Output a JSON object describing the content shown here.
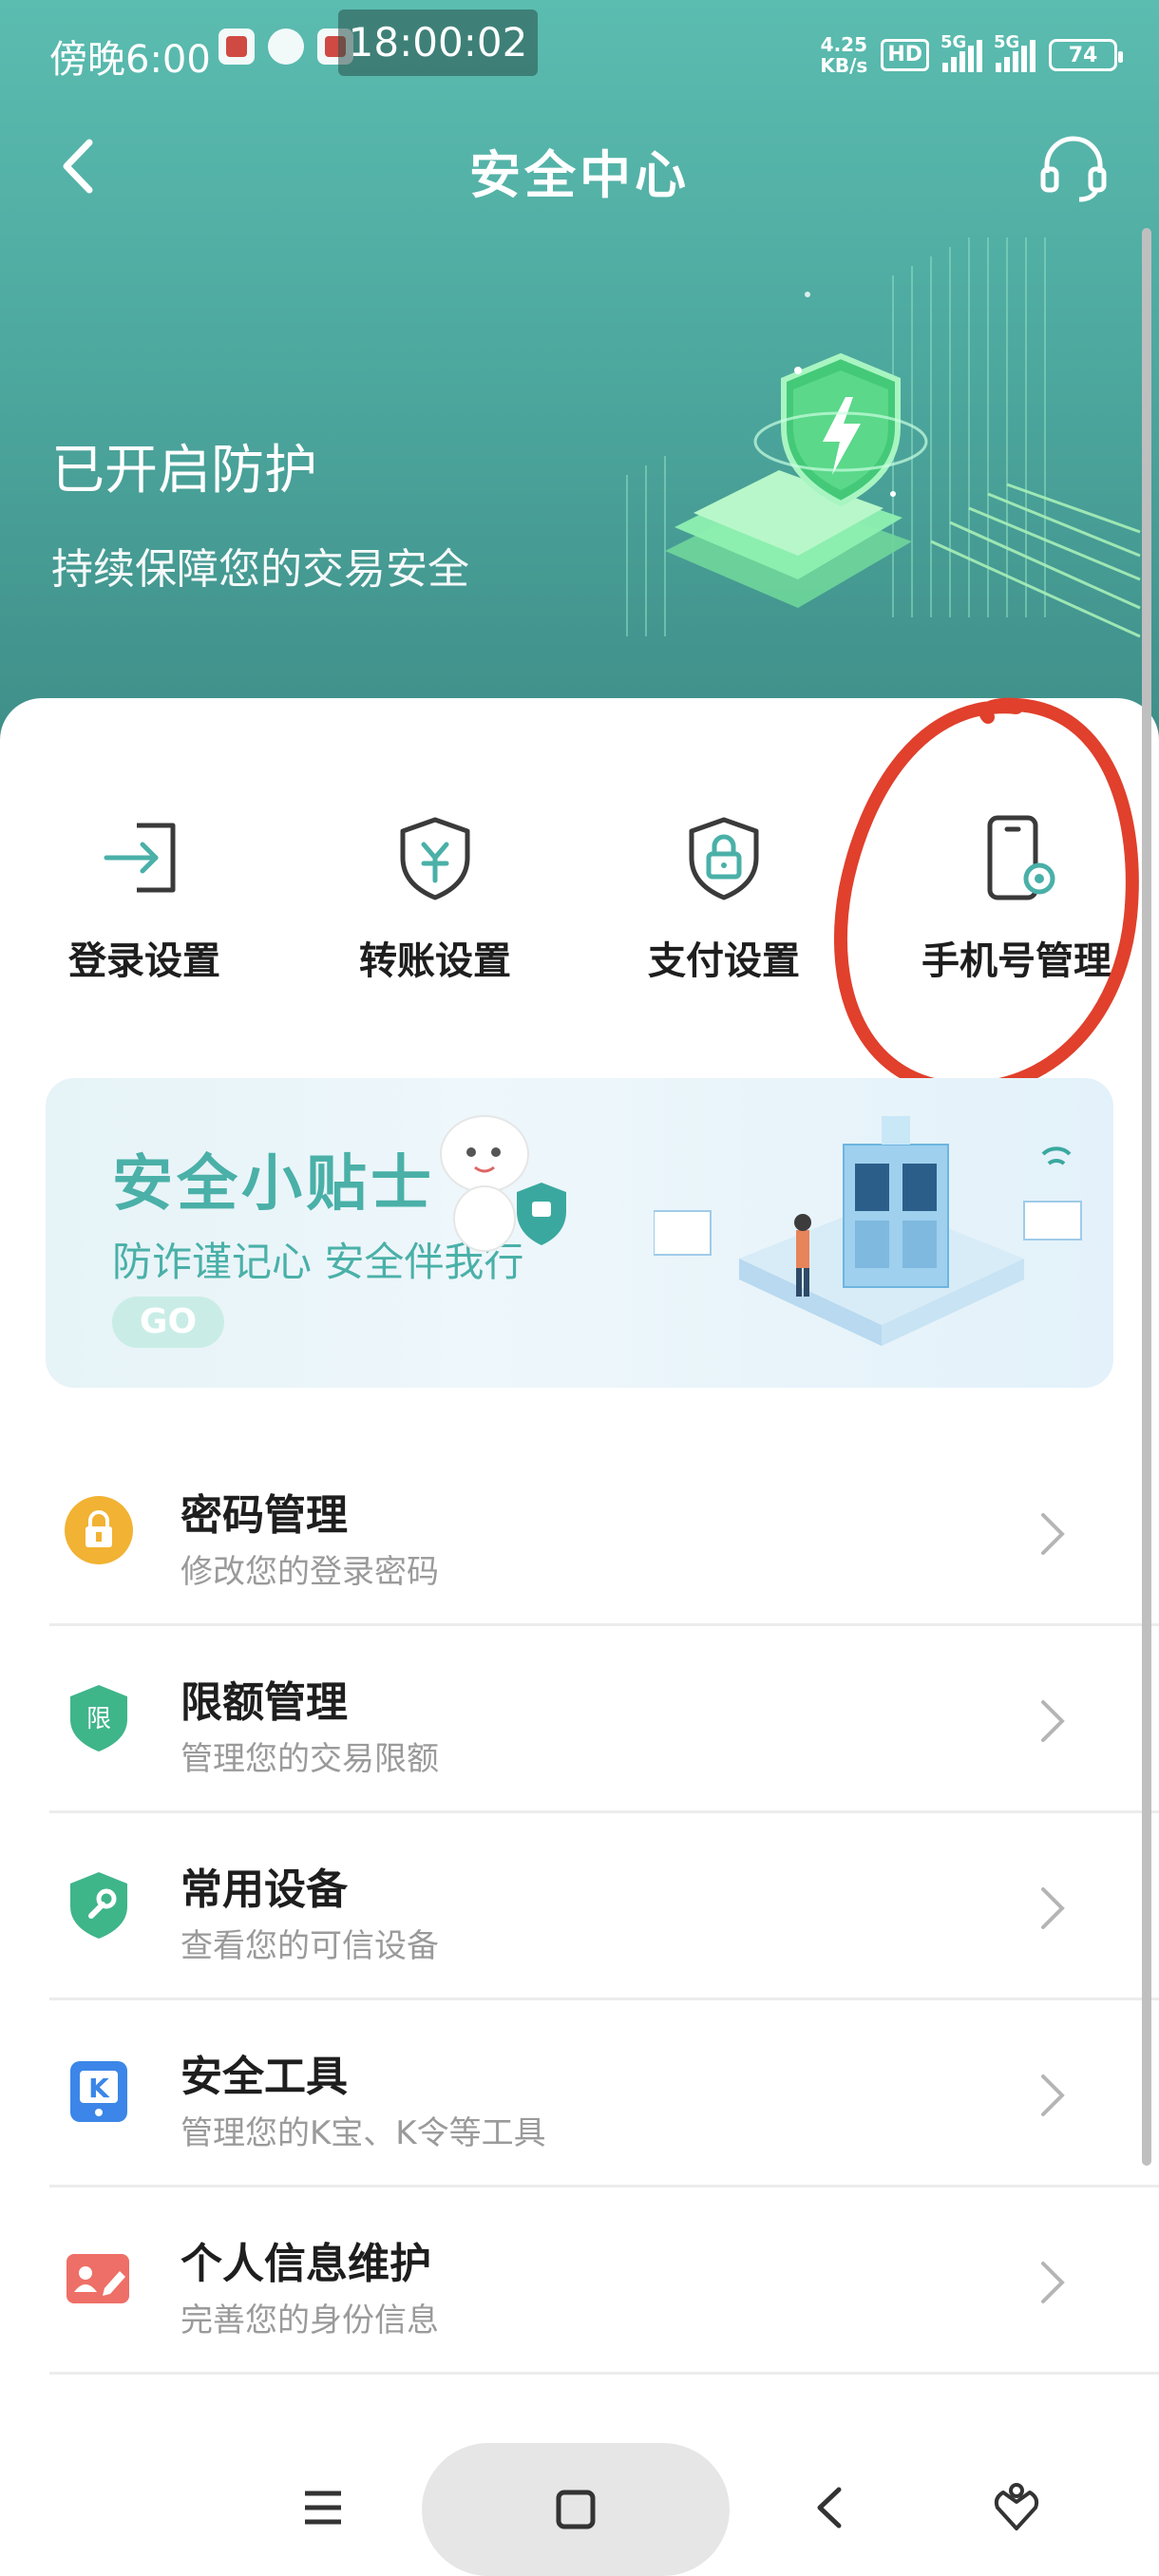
{
  "status_bar": {
    "time": "傍晚6:00",
    "clock": "18:00:02",
    "netspeed_value": "4.25",
    "netspeed_unit": "KB/s",
    "hd": "HD",
    "sim1": "5G",
    "sim2": "5G",
    "battery": "74"
  },
  "nav": {
    "title": "安全中心"
  },
  "hero": {
    "title": "已开启防护",
    "subtitle": "持续保障您的交易安全"
  },
  "quick_actions": [
    {
      "label": "登录设置",
      "icon": "login-icon"
    },
    {
      "label": "转账设置",
      "icon": "yuan-shield-icon"
    },
    {
      "label": "支付设置",
      "icon": "lock-shield-icon"
    },
    {
      "label": "手机号管理",
      "icon": "phone-settings-icon"
    }
  ],
  "banner": {
    "title": "安全小贴士",
    "subtitle": "防诈谨记心 安全伴我行",
    "go_label": "GO"
  },
  "menu": [
    {
      "title": "密码管理",
      "subtitle": "修改您的登录密码",
      "icon": "padlock-icon",
      "color": "#f2b233"
    },
    {
      "title": "限额管理",
      "subtitle": "管理您的交易限额",
      "icon": "limit-shield-icon",
      "color": "#3fb58a",
      "badge": "限"
    },
    {
      "title": "常用设备",
      "subtitle": "查看您的可信设备",
      "icon": "wrench-shield-icon",
      "color": "#3fb58a"
    },
    {
      "title": "安全工具",
      "subtitle": "管理您的K宝、K令等工具",
      "icon": "k-token-icon",
      "color": "#3b86e8",
      "badge": "K"
    },
    {
      "title": "个人信息维护",
      "subtitle": "完善您的身份信息",
      "icon": "id-card-icon",
      "color": "#ee6f67"
    }
  ],
  "colors": {
    "header_teal": "#4eaaa0",
    "accent_teal": "#4ab0a8",
    "annotation_red": "#e0402c"
  }
}
